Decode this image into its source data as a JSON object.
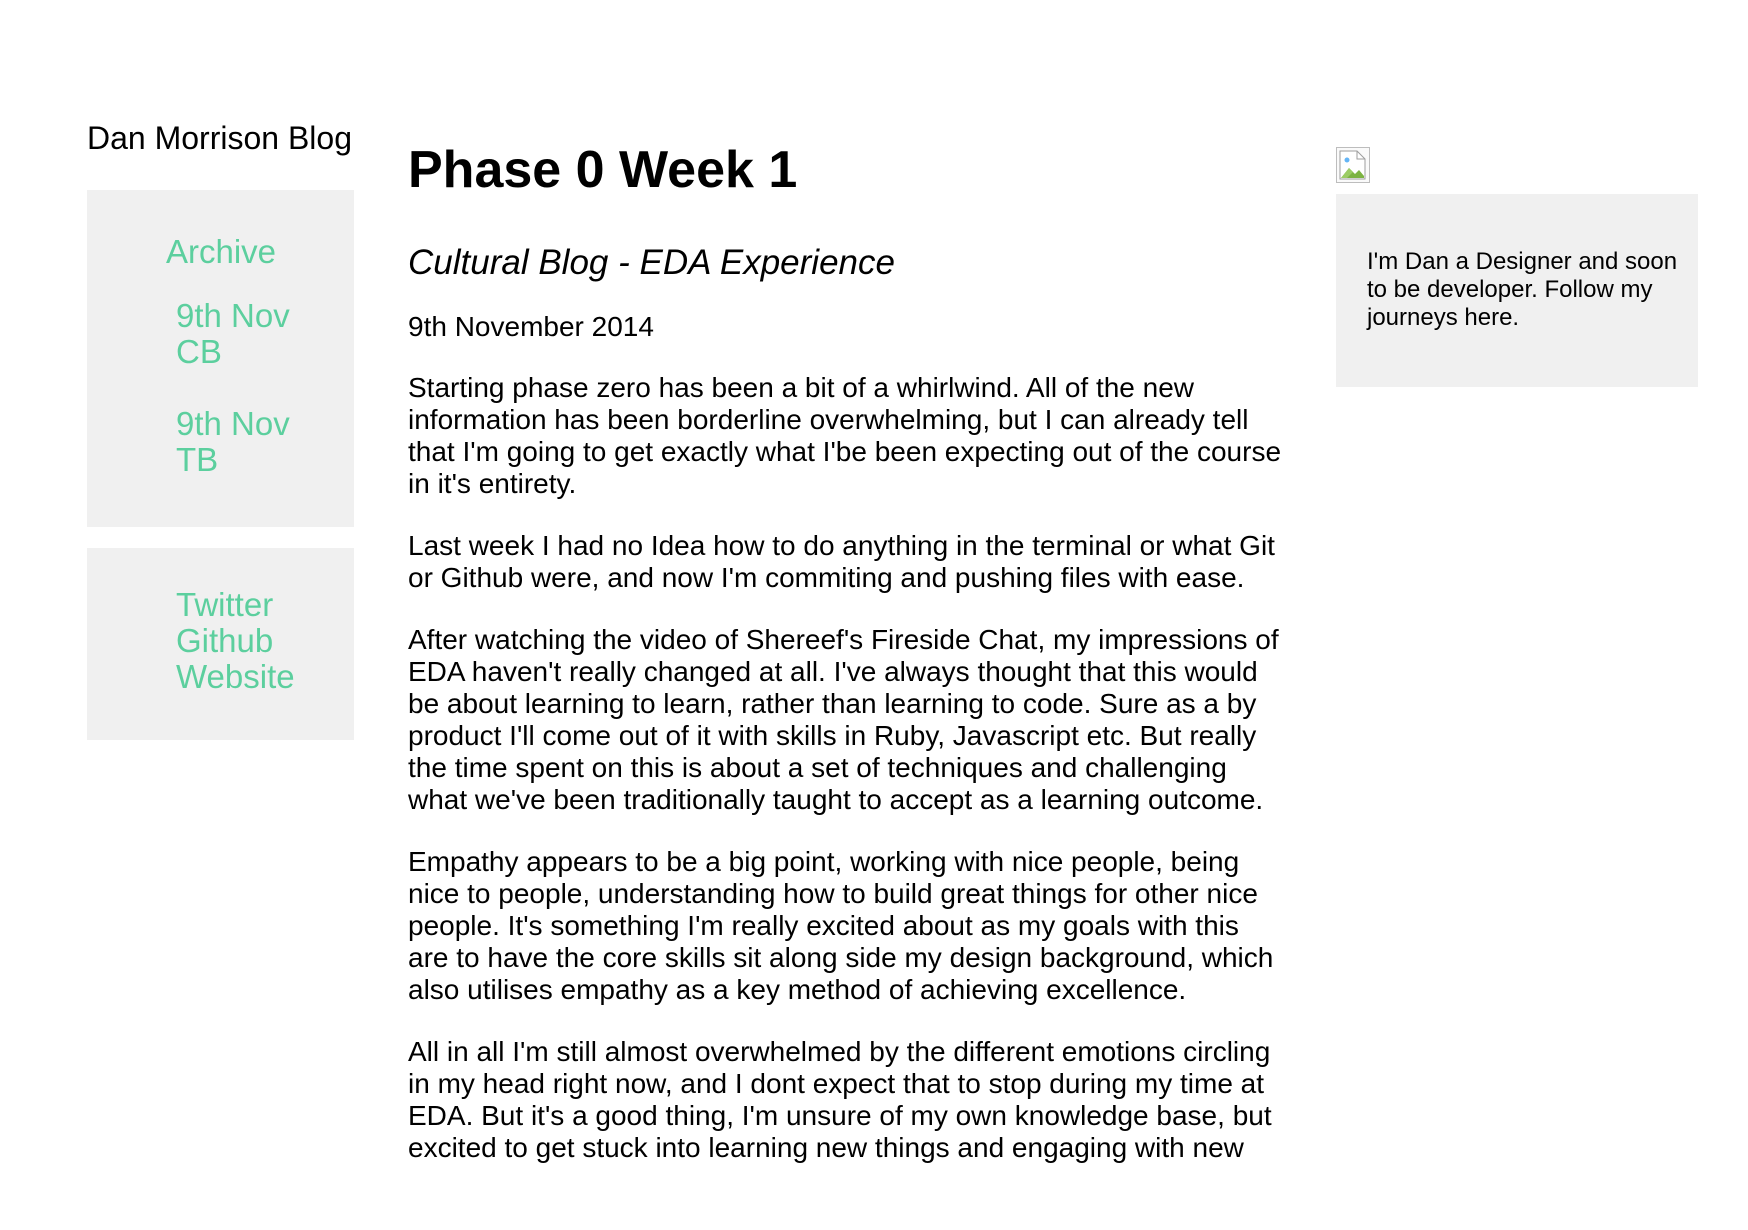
{
  "site": {
    "title": "Dan Morrison Blog"
  },
  "archive": {
    "heading": "Archive",
    "items": [
      {
        "label": "9th Nov CB"
      },
      {
        "label": "9th Nov TB"
      }
    ]
  },
  "social": {
    "items": [
      {
        "label": "Twitter"
      },
      {
        "label": "Github"
      },
      {
        "label": "Website"
      }
    ]
  },
  "post": {
    "title": "Phase 0 Week 1",
    "subtitle": "Cultural Blog - EDA Experience",
    "date": "9th November 2014",
    "paragraphs": [
      "Starting phase zero has been a bit of a whirlwind. All of the new information has been borderline overwhelming, but I can already tell that I'm going to get exactly what I'be been expecting out of the course in it's entirety.",
      "Last week I had no Idea how to do anything in the terminal or what Git or Github were, and now I'm commiting and pushing files with ease.",
      "After watching the video of Shereef's Fireside Chat, my impressions of EDA haven't really changed at all. I've always thought that this would be about learning to learn, rather than learning to code. Sure as a by product I'll come out of it with skills in Ruby, Javascript etc. But really the time spent on this is about a set of techniques and challenging what we've been traditionally taught to accept as a learning outcome.",
      "Empathy appears to be a big point, working with nice people, being nice to people, understanding how to build great things for other nice people. It's something I'm really excited about as my goals with this are to have the core skills sit along side my design background, which also utilises empathy as a key method of achieving excellence.",
      "All in all I'm still almost overwhelmed by the different emotions circling in my head right now, and I dont expect that to stop during my time at EDA. But it's a good thing, I'm unsure of my own knowledge base, but excited to get stuck into learning new things and engaging with new"
    ]
  },
  "profile": {
    "image_icon": "broken-image-icon",
    "bio": "I'm Dan a Designer and soon to be developer. Follow my journeys here."
  },
  "colors": {
    "accent": "#5ccf9e",
    "panel": "#f0f0f0"
  }
}
